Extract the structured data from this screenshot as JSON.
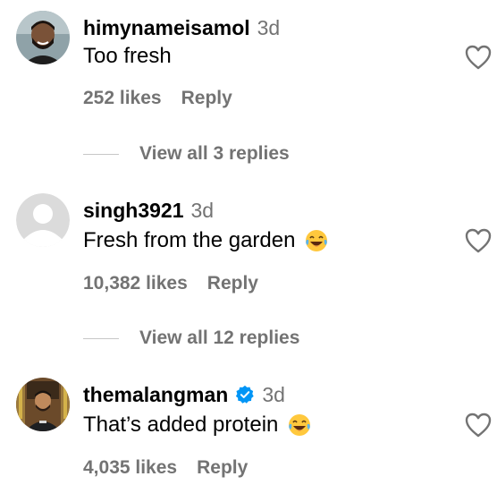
{
  "comments": [
    {
      "username": "himynameisamol",
      "timestamp": "3d",
      "text": "Too fresh",
      "likes": "252 likes",
      "reply_label": "Reply",
      "view_replies": "View all 3 replies",
      "avatar": "profile-photo-man-beard",
      "verified": false,
      "emoji": null
    },
    {
      "username": "singh3921",
      "timestamp": "3d",
      "text": "Fresh from the garden",
      "likes": "10,382 likes",
      "reply_label": "Reply",
      "view_replies": "View all 12 replies",
      "avatar": "default-avatar",
      "verified": false,
      "emoji": "laughing-tears-emoji"
    },
    {
      "username": "themalangman",
      "timestamp": "3d",
      "text": "That’s added protein",
      "likes": "4,035 likes",
      "reply_label": "Reply",
      "avatar": "profile-photo-man-library",
      "verified": true,
      "emoji": "laughing-tears-emoji"
    }
  ],
  "colors": {
    "text_primary": "#000000",
    "text_secondary": "#737373",
    "verified_blue": "#0095f6",
    "divider": "#c7c7c7"
  }
}
